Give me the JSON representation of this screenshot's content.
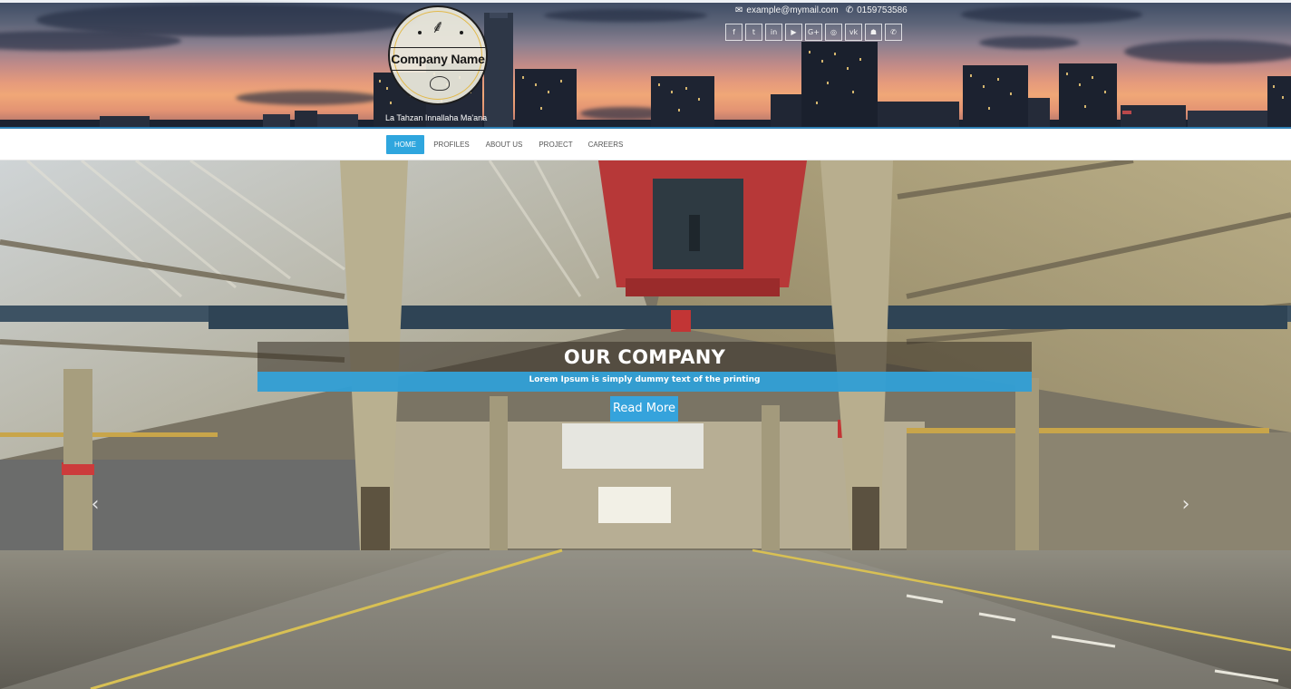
{
  "header": {
    "logo": {
      "text": "Company Name",
      "icon": "wheat-icon"
    },
    "tagline": "La Tahzan Innallaha Ma'ana",
    "contact": {
      "email_icon": "envelope-icon",
      "email": "example@mymail.com",
      "phone_icon": "phone-icon",
      "phone": "0159753586"
    },
    "socials": [
      {
        "name": "facebook-icon",
        "glyph": "f"
      },
      {
        "name": "twitter-icon",
        "glyph": "t"
      },
      {
        "name": "linkedin-icon",
        "glyph": "in"
      },
      {
        "name": "youtube-icon",
        "glyph": "▶"
      },
      {
        "name": "google-plus-icon",
        "glyph": "G+"
      },
      {
        "name": "instagram-icon",
        "glyph": "◎"
      },
      {
        "name": "vk-icon",
        "glyph": "vk"
      },
      {
        "name": "snapchat-icon",
        "glyph": "☗"
      },
      {
        "name": "whatsapp-icon",
        "glyph": "✆"
      }
    ]
  },
  "nav": {
    "items": [
      {
        "label": "HOME",
        "active": true
      },
      {
        "label": "PROFILES"
      },
      {
        "label": "ABOUT US"
      },
      {
        "label": "PROJECT"
      },
      {
        "label": "CAREERS"
      }
    ]
  },
  "hero": {
    "title": "OUR COMPANY",
    "subtitle": "Lorem Ipsum is simply dummy text of the printing",
    "button": "Read More",
    "prev_icon": "‹",
    "next_icon": "›"
  },
  "colors": {
    "accent": "#2fa6de",
    "caption_bar": "#32a4dc",
    "logo_ring": "#e2b94a"
  }
}
